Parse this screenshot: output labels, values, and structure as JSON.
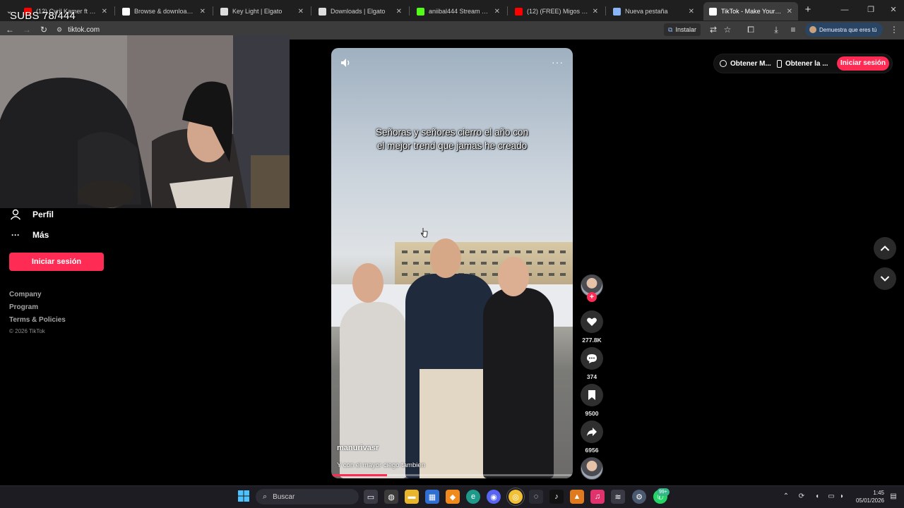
{
  "browser": {
    "tabs": [
      {
        "label": "(12) Cyril Kamer ft Slayter",
        "favicon_color": "#ff0000"
      },
      {
        "label": "Browse & download millio",
        "favicon_color": "#ffffff"
      },
      {
        "label": "Key Light | Elgato",
        "favicon_color": "#dddddd"
      },
      {
        "label": "Downloads | Elgato",
        "favicon_color": "#dddddd"
      },
      {
        "label": "aniibal444 Stream - Watch",
        "favicon_color": "#53fc18"
      },
      {
        "label": "(12) (FREE) Migos Type Be",
        "favicon_color": "#ff0000"
      },
      {
        "label": "Nueva pestaña",
        "favicon_color": "#8ab4f8"
      },
      {
        "label": "TikTok - Make Your Da",
        "favicon_color": "#ffffff"
      }
    ],
    "url": "tiktok.com",
    "install_label": "Instalar",
    "profile_label": "Demuestra que eres tú"
  },
  "overlay": {
    "subs_text": "SUBS 78/444"
  },
  "sidebar": {
    "items": [
      {
        "label": "Perfil",
        "icon": "person-icon"
      },
      {
        "label": "Más",
        "icon": "more-dots-icon"
      }
    ],
    "login_label": "Iniciar sesión",
    "footer": {
      "company": "Company",
      "program": "Program",
      "terms": "Terms & Policies",
      "copyright": "© 2026 TikTok"
    }
  },
  "header": {
    "get_coins": "Obtener M...",
    "get_app": "Obtener la ...",
    "login": "Iniciar sesión"
  },
  "video": {
    "caption": "Señoras y señores cierro el año con el mejor trend que jamas he creado",
    "author": "manurivasr",
    "description": "Y con el mayor ciego tambien",
    "progress_fraction": 0.23
  },
  "actions": {
    "likes": "277.8K",
    "comments": "374",
    "saves": "9500",
    "shares": "6956"
  },
  "taskbar": {
    "search_placeholder": "Buscar",
    "time": "1:45",
    "date": "05/01/2026",
    "badge": "99+"
  },
  "colors": {
    "accent": "#fe2c55"
  }
}
